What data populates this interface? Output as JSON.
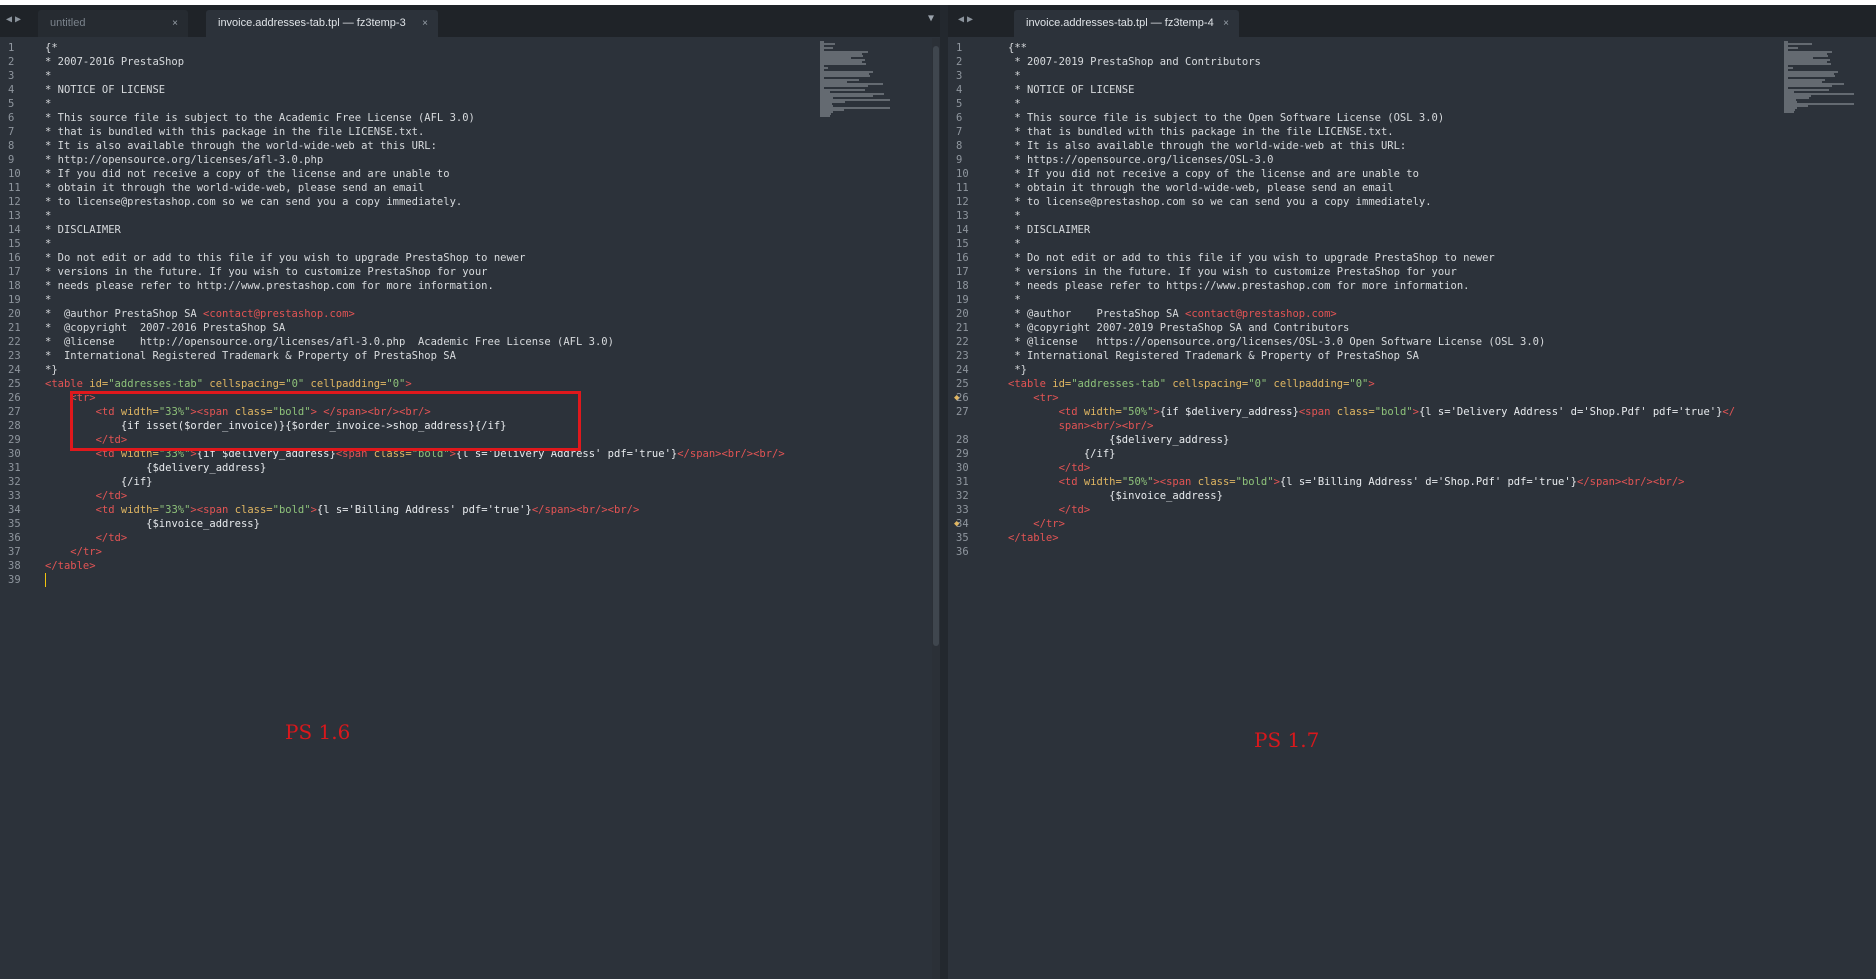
{
  "left": {
    "tabs": [
      {
        "label": "untitled",
        "close": "×"
      },
      {
        "label": "invoice.addresses-tab.tpl — fz3temp-3",
        "close": "×"
      }
    ],
    "annotation": "PS 1.6",
    "lines": [
      {
        "n": "1",
        "html": "<span class='c'>{*</span>"
      },
      {
        "n": "2",
        "html": "<span class='c'>* 2007-2016 PrestaShop</span>"
      },
      {
        "n": "3",
        "html": "<span class='c'>*</span>"
      },
      {
        "n": "4",
        "html": "<span class='c'>* NOTICE OF LICENSE</span>"
      },
      {
        "n": "5",
        "html": "<span class='c'>*</span>"
      },
      {
        "n": "6",
        "html": "<span class='c'>* This source file is subject to the Academic Free License (AFL 3.0)</span>"
      },
      {
        "n": "7",
        "html": "<span class='c'>* that is bundled with this package in the file LICENSE.txt.</span>"
      },
      {
        "n": "8",
        "html": "<span class='c'>* It is also available through the world-wide-web at this URL:</span>"
      },
      {
        "n": "9",
        "html": "<span class='c'>* http://opensource.org/licenses/afl-3.0.php</span>"
      },
      {
        "n": "10",
        "html": "<span class='c'>* If you did not receive a copy of the license and are unable to</span>"
      },
      {
        "n": "11",
        "html": "<span class='c'>* obtain it through the world-wide-web, please send an email</span>"
      },
      {
        "n": "12",
        "html": "<span class='c'>* to license@prestashop.com so we can send you a copy immediately.</span>"
      },
      {
        "n": "13",
        "html": "<span class='c'>*</span>"
      },
      {
        "n": "14",
        "html": "<span class='c'>* DISCLAIMER</span>"
      },
      {
        "n": "15",
        "html": "<span class='c'>*</span>"
      },
      {
        "n": "16",
        "html": "<span class='c'>* Do not edit or add to this file if you wish to upgrade PrestaShop to newer</span>"
      },
      {
        "n": "17",
        "html": "<span class='c'>* versions in the future. If you wish to customize PrestaShop for your</span>"
      },
      {
        "n": "18",
        "html": "<span class='c'>* needs please refer to http://www.prestashop.com for more information.</span>"
      },
      {
        "n": "19",
        "html": "<span class='c'>*</span>"
      },
      {
        "n": "20",
        "html": "<span class='c'>*  @author PrestaShop SA </span><span class='tag'>&lt;contact@prestashop.com&gt;</span>"
      },
      {
        "n": "21",
        "html": "<span class='c'>*  @copyright  2007-2016 PrestaShop SA</span>"
      },
      {
        "n": "22",
        "html": "<span class='c'>*  @license    http://opensource.org/licenses/afl-3.0.php  Academic Free License (AFL 3.0)</span>"
      },
      {
        "n": "23",
        "html": "<span class='c'>*  International Registered Trademark &amp; Property of PrestaShop SA</span>"
      },
      {
        "n": "24",
        "html": "<span class='c'>*}</span>"
      },
      {
        "n": "25",
        "html": "<span class='tag'>&lt;table</span> <span class='attr'>id=</span><span class='str'>\"addresses-tab\"</span> <span class='attr'>cellspacing=</span><span class='str'>\"0\"</span> <span class='attr'>cellpadding=</span><span class='str'>\"0\"</span><span class='tag'>&gt;</span>"
      },
      {
        "n": "26",
        "html": "    <span class='tag'>&lt;tr&gt;</span>"
      },
      {
        "n": "27",
        "html": "        <span class='tag'>&lt;td</span> <span class='attr'>width=</span><span class='str'>\"33%\"</span><span class='tag'>&gt;&lt;span</span> <span class='attr'>class=</span><span class='str'>\"bold\"</span><span class='tag'>&gt;</span> <span class='tag'>&lt;/span&gt;&lt;br/&gt;&lt;br/&gt;</span>"
      },
      {
        "n": "28",
        "html": "            <span class='kw'>{if isset($order_invoice)}{$order_invoice-&gt;shop_address}{/if}</span>"
      },
      {
        "n": "29",
        "html": "        <span class='tag'>&lt;/td&gt;</span>"
      },
      {
        "n": "30",
        "html": "        <span class='tag'>&lt;td</span> <span class='attr'>width=</span><span class='str'>\"33%\"</span><span class='tag'>&gt;</span><span class='kw'>{if $delivery_address}</span><span class='tag'>&lt;span</span> <span class='attr'>class=</span><span class='str'>\"bold\"</span><span class='tag'>&gt;</span><span class='kw'>{l s='Delivery Address' pdf='true'}</span><span class='tag'>&lt;/span&gt;&lt;br/&gt;&lt;br/&gt;</span>"
      },
      {
        "n": "31",
        "html": "                <span class='kw'>{$delivery_address}</span>"
      },
      {
        "n": "32",
        "html": "            <span class='kw'>{/if}</span>"
      },
      {
        "n": "33",
        "html": "        <span class='tag'>&lt;/td&gt;</span>"
      },
      {
        "n": "34",
        "html": "        <span class='tag'>&lt;td</span> <span class='attr'>width=</span><span class='str'>\"33%\"</span><span class='tag'>&gt;&lt;span</span> <span class='attr'>class=</span><span class='str'>\"bold\"</span><span class='tag'>&gt;</span><span class='kw'>{l s='Billing Address' pdf='true'}</span><span class='tag'>&lt;/span&gt;&lt;br/&gt;&lt;br/&gt;</span>"
      },
      {
        "n": "35",
        "html": "                <span class='kw'>{$invoice_address}</span>"
      },
      {
        "n": "36",
        "html": "        <span class='tag'>&lt;/td&gt;</span>"
      },
      {
        "n": "37",
        "html": "    <span class='tag'>&lt;/tr&gt;</span>"
      },
      {
        "n": "38",
        "html": "<span class='tag'>&lt;/table&gt;</span>"
      },
      {
        "n": "39",
        "html": ""
      }
    ]
  },
  "right": {
    "tabs": [
      {
        "label": "invoice.addresses-tab.tpl — fz3temp-4",
        "close": "×"
      }
    ],
    "annotation": "PS 1.7",
    "lines": [
      {
        "n": "1",
        "html": "<span class='c'>{**</span>"
      },
      {
        "n": "2",
        "html": "<span class='c'> * 2007-2019 PrestaShop and Contributors</span>"
      },
      {
        "n": "3",
        "html": "<span class='c'> *</span>"
      },
      {
        "n": "4",
        "html": "<span class='c'> * NOTICE OF LICENSE</span>"
      },
      {
        "n": "5",
        "html": "<span class='c'> *</span>"
      },
      {
        "n": "6",
        "html": "<span class='c'> * This source file is subject to the Open Software License (OSL 3.0)</span>"
      },
      {
        "n": "7",
        "html": "<span class='c'> * that is bundled with this package in the file LICENSE.txt.</span>"
      },
      {
        "n": "8",
        "html": "<span class='c'> * It is also available through the world-wide-web at this URL:</span>"
      },
      {
        "n": "9",
        "html": "<span class='c'> * https://opensource.org/licenses/OSL-3.0</span>"
      },
      {
        "n": "10",
        "html": "<span class='c'> * If you did not receive a copy of the license and are unable to</span>"
      },
      {
        "n": "11",
        "html": "<span class='c'> * obtain it through the world-wide-web, please send an email</span>"
      },
      {
        "n": "12",
        "html": "<span class='c'> * to license@prestashop.com so we can send you a copy immediately.</span>"
      },
      {
        "n": "13",
        "html": "<span class='c'> *</span>"
      },
      {
        "n": "14",
        "html": "<span class='c'> * DISCLAIMER</span>"
      },
      {
        "n": "15",
        "html": "<span class='c'> *</span>"
      },
      {
        "n": "16",
        "html": "<span class='c'> * Do not edit or add to this file if you wish to upgrade PrestaShop to newer</span>"
      },
      {
        "n": "17",
        "html": "<span class='c'> * versions in the future. If you wish to customize PrestaShop for your</span>"
      },
      {
        "n": "18",
        "html": "<span class='c'> * needs please refer to https://www.prestashop.com for more information.</span>"
      },
      {
        "n": "19",
        "html": "<span class='c'> *</span>"
      },
      {
        "n": "20",
        "html": "<span class='c'> * @author    PrestaShop SA </span><span class='tag'>&lt;contact@prestashop.com&gt;</span>"
      },
      {
        "n": "21",
        "html": "<span class='c'> * @copyright 2007-2019 PrestaShop SA and Contributors</span>"
      },
      {
        "n": "22",
        "html": "<span class='c'> * @license   https://opensource.org/licenses/OSL-3.0 Open Software License (OSL 3.0)</span>"
      },
      {
        "n": "23",
        "html": "<span class='c'> * International Registered Trademark &amp; Property of PrestaShop SA</span>"
      },
      {
        "n": "24",
        "html": "<span class='c'> *}</span>"
      },
      {
        "n": "25",
        "html": "<span class='tag'>&lt;table</span> <span class='attr'>id=</span><span class='str'>\"addresses-tab\"</span> <span class='attr'>cellspacing=</span><span class='str'>\"0\"</span> <span class='attr'>cellpadding=</span><span class='str'>\"0\"</span><span class='tag'>&gt;</span>"
      },
      {
        "n": "26",
        "html": "    <span class='tag'>&lt;tr&gt;</span>",
        "mark": true
      },
      {
        "n": "27",
        "html": "        <span class='tag'>&lt;td</span> <span class='attr'>width=</span><span class='str'>\"50%\"</span><span class='tag'>&gt;</span><span class='kw'>{if $delivery_address}</span><span class='tag'>&lt;span</span> <span class='attr'>class=</span><span class='str'>\"bold\"</span><span class='tag'>&gt;</span><span class='kw'>{l s='Delivery Address' d='Shop.Pdf' pdf='true'}</span><span class='tag'>&lt;/</span>"
      },
      {
        "n": "",
        "html": "        <span class='tag'>span&gt;&lt;br/&gt;&lt;br/&gt;</span>"
      },
      {
        "n": "28",
        "html": "                <span class='kw'>{$delivery_address}</span>"
      },
      {
        "n": "29",
        "html": "            <span class='kw'>{/if}</span>"
      },
      {
        "n": "30",
        "html": "        <span class='tag'>&lt;/td&gt;</span>"
      },
      {
        "n": "31",
        "html": "        <span class='tag'>&lt;td</span> <span class='attr'>width=</span><span class='str'>\"50%\"</span><span class='tag'>&gt;&lt;span</span> <span class='attr'>class=</span><span class='str'>\"bold\"</span><span class='tag'>&gt;</span><span class='kw'>{l s='Billing Address' d='Shop.Pdf' pdf='true'}</span><span class='tag'>&lt;/span&gt;&lt;br/&gt;&lt;br/&gt;</span>"
      },
      {
        "n": "32",
        "html": "                <span class='kw'>{$invoice_address}</span>"
      },
      {
        "n": "33",
        "html": "        <span class='tag'>&lt;/td&gt;</span>"
      },
      {
        "n": "34",
        "html": "    <span class='tag'>&lt;/tr&gt;</span>",
        "mark": true
      },
      {
        "n": "35",
        "html": "<span class='tag'>&lt;/table&gt;</span>"
      },
      {
        "n": "36",
        "html": ""
      }
    ]
  }
}
